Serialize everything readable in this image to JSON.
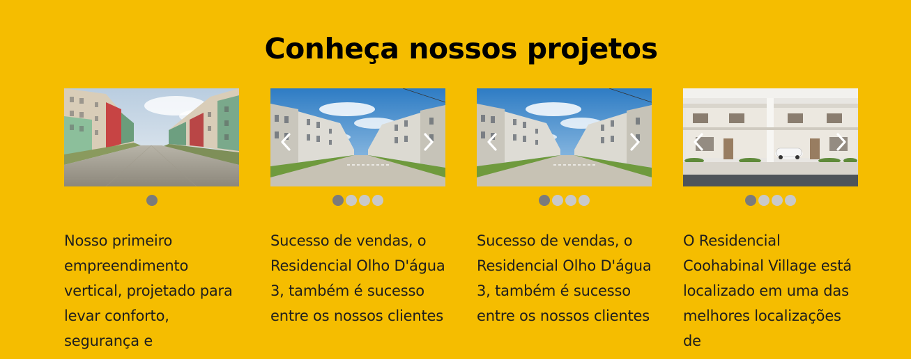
{
  "section": {
    "title": "Conheça nossos projetos"
  },
  "projects": [
    {
      "image": "residential-buildings-street-photo",
      "slides": 1,
      "active_slide": 1,
      "has_arrows": false,
      "description": "Nosso primeiro empreendimento vertical, projetado para levar conforto, segurança e"
    },
    {
      "image": "olho-dagua-buildings-photo",
      "slides": 4,
      "active_slide": 1,
      "has_arrows": true,
      "description": "Sucesso de vendas, o Residencial Olho D'água 3, também é sucesso entre os nossos clientes"
    },
    {
      "image": "olho-dagua-buildings-photo",
      "slides": 4,
      "active_slide": 1,
      "has_arrows": true,
      "description": "Sucesso de vendas, o Residencial Olho D'água 3, também é sucesso entre os nossos clientes"
    },
    {
      "image": "coohabinal-village-townhouses-photo",
      "slides": 4,
      "active_slide": 1,
      "has_arrows": true,
      "description": "O Residencial Coohabinal Village está localizado em uma das melhores localizações de"
    }
  ],
  "icons": {
    "prev": "chevron-left-icon",
    "next": "chevron-right-icon"
  },
  "colors": {
    "background": "#f5bd00",
    "title": "#000000",
    "text": "#1e1e1e",
    "dot_active": "#7b7b7b",
    "dot_inactive": "#c9c9c9"
  }
}
